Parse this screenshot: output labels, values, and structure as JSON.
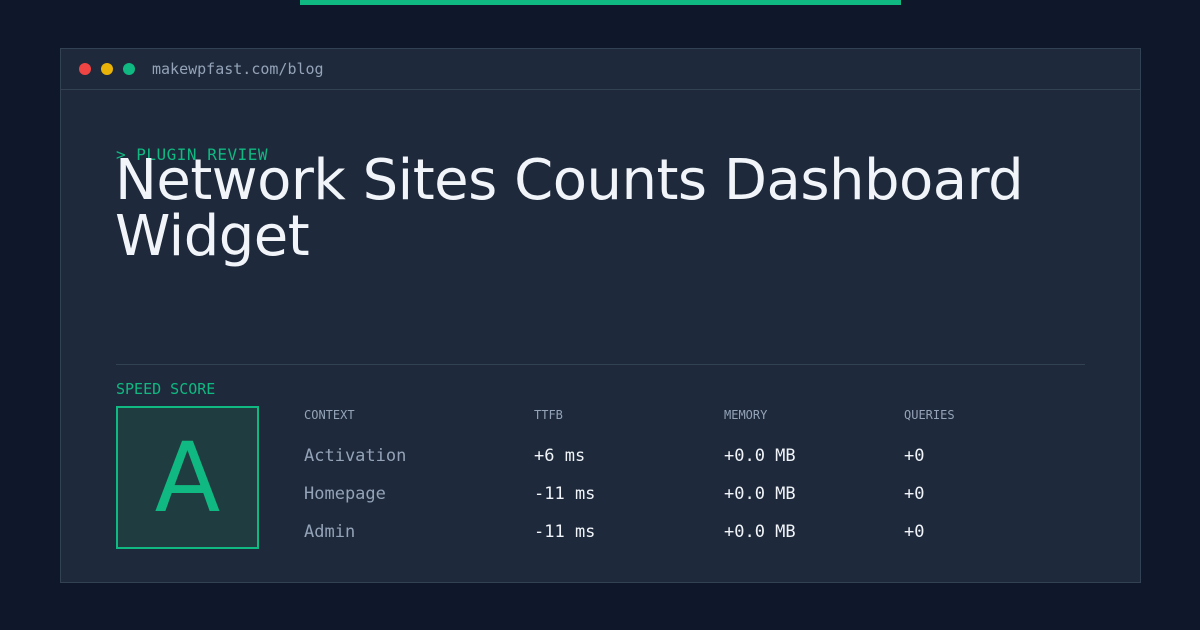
{
  "colors": {
    "accent": "#10b981",
    "dot_red": "#ef4444",
    "dot_yellow": "#eab308",
    "dot_green": "#10b981"
  },
  "window": {
    "url": "makewpfast.com/blog"
  },
  "eyebrow": "> PLUGIN REVIEW",
  "title": "Network Sites Counts Dashboard Widget",
  "speed_score": {
    "label": "SPEED SCORE",
    "grade": "A"
  },
  "table": {
    "headers": [
      "CONTEXT",
      "TTFB",
      "MEMORY",
      "QUERIES"
    ],
    "rows": [
      [
        "Activation",
        "+6 ms",
        "+0.0 MB",
        "+0"
      ],
      [
        "Homepage",
        "-11 ms",
        "+0.0 MB",
        "+0"
      ],
      [
        "Admin",
        "-11 ms",
        "+0.0 MB",
        "+0"
      ]
    ]
  }
}
